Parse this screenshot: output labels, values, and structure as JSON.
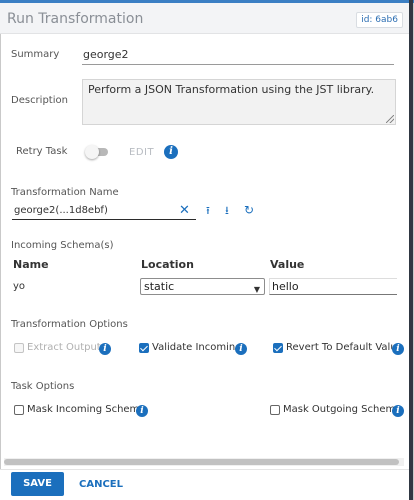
{
  "header": {
    "title": "Run Transformation",
    "id_badge": "id: 6ab6"
  },
  "summary": {
    "label": "Summary",
    "value": "george2"
  },
  "description": {
    "label": "Description",
    "value": "Perform a JSON Transformation using the JST library."
  },
  "retry_task": {
    "label": "Retry Task",
    "toggle_on": false,
    "edit_label": "EDIT"
  },
  "transformation_name": {
    "label": "Transformation Name",
    "value": "george2(...1d8ebf)"
  },
  "incoming_schemas": {
    "label": "Incoming Schema(s)",
    "columns": [
      "Name",
      "Location",
      "Value"
    ],
    "rows": [
      {
        "name": "yo",
        "location": "static",
        "value": "hello"
      }
    ]
  },
  "transformation_options": {
    "label": "Transformation Options",
    "items": [
      {
        "label": "Extract Output",
        "checked": false,
        "disabled": true
      },
      {
        "label": "Validate Incoming",
        "checked": true,
        "disabled": false
      },
      {
        "label": "Revert To Default Value",
        "checked": true,
        "disabled": false
      }
    ]
  },
  "task_options": {
    "label": "Task Options",
    "items": [
      {
        "label": "Mask Incoming Schema",
        "checked": false
      },
      {
        "label": "Mask Outgoing Schema",
        "checked": false
      }
    ]
  },
  "footer": {
    "save_label": "SAVE",
    "cancel_label": "CANCEL"
  },
  "icons": {
    "info": "i",
    "clear": "✕",
    "upload": "⭱",
    "download": "⭳",
    "refresh": "↻",
    "caret": "▼"
  },
  "colors": {
    "accent": "#1b6fbd",
    "header_bg": "#f3f4f6"
  }
}
